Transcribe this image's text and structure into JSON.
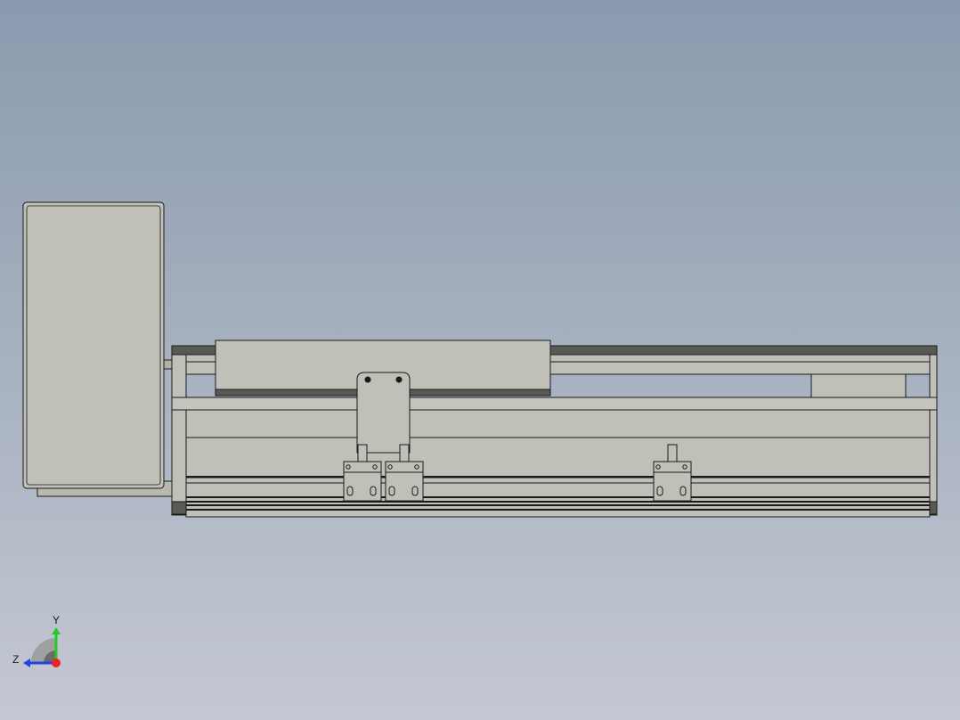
{
  "viewport": {
    "background_top": "#8a9aae",
    "background_bottom": "#c4c8d2"
  },
  "model": {
    "part_fill": "#c0c0b8",
    "part_shade": "#a8a8a0",
    "edge_color": "#1a1a1a",
    "dark_band": "#5a5a55"
  },
  "triad": {
    "y_label": "Y",
    "z_label": "Z",
    "y_color": "#22cc22",
    "z_color": "#2244dd",
    "x_color": "#ee2222"
  }
}
